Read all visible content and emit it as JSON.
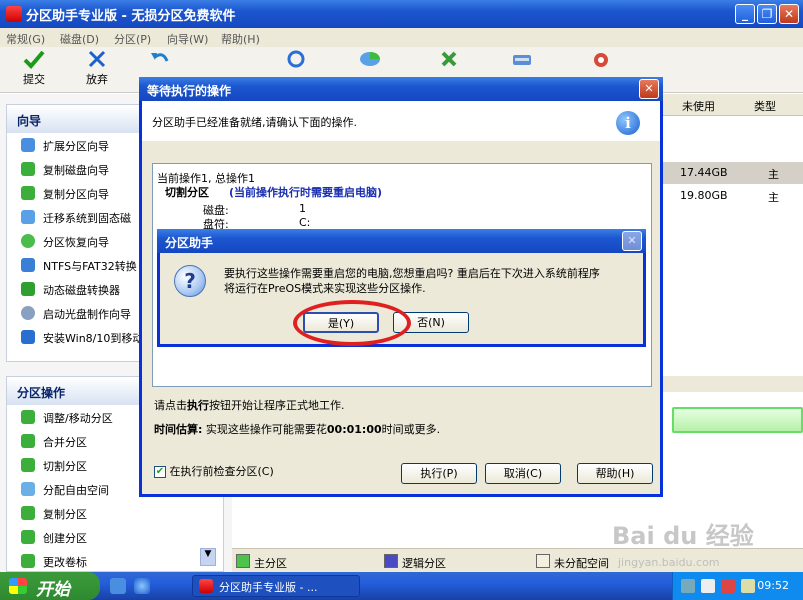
{
  "window": {
    "title": "分区助手专业版 - 无损分区免费软件",
    "buttons": {
      "minimize": "_",
      "maximize": "❐",
      "close": "✕"
    }
  },
  "menubar": [
    "常规(G)",
    "磁盘(D)",
    "分区(P)",
    "向导(W)",
    "帮助(H)"
  ],
  "toolbar": {
    "commit": "提交",
    "discard": "放弃"
  },
  "wizard_panel": {
    "title": "向导",
    "items": [
      "扩展分区向导",
      "复制磁盘向导",
      "复制分区向导",
      "迁移系统到固态磁",
      "分区恢复向导",
      "NTFS与FAT32转换",
      "动态磁盘转换器",
      "启动光盘制作向导",
      "安装Win8/10到移动"
    ]
  },
  "partition_ops_panel": {
    "title": "分区操作",
    "items": [
      "调整/移动分区",
      "合并分区",
      "切割分区",
      "分配自由空间",
      "复制分区",
      "创建分区",
      "更改卷标"
    ]
  },
  "disk_list": {
    "columns": {
      "unused": "未使用",
      "type": "类型"
    },
    "rows": [
      {
        "unused": "17.44GB",
        "type": "主"
      },
      {
        "unused": "19.80GB",
        "type": "主"
      }
    ]
  },
  "legend": {
    "primary": "主分区",
    "logical": "逻辑分区",
    "unallocated": "未分配空间"
  },
  "pending_dialog": {
    "title": "等待执行的操作",
    "message": "分区助手已经准备就绪,请确认下面的操作.",
    "info_icon": "i",
    "op_header": "当前操作1, 总操作1",
    "op_name": "切割分区",
    "op_note": "(当前操作执行时需要重启电脑)",
    "op_disk_label": "磁盘:",
    "op_disk_value": "1",
    "op_letter_label": "盘符:",
    "op_letter_value": "C:",
    "note_prefix": "请点击",
    "note_bold": "执行",
    "note_suffix": "按钮开始让程序正式地工作.",
    "estimate_label": "时间估算:",
    "estimate_prefix": " 实现这些操作可能需要花",
    "estimate_time": "00:01:00",
    "estimate_suffix": "时间或更多.",
    "check_label": "在执行前检查分区(C)",
    "execute": "执行(P)",
    "cancel": "取消(C)",
    "help": "帮助(H)"
  },
  "confirm_dialog": {
    "title": "分区助手",
    "icon": "?",
    "line1": "要执行这些操作需要重启您的电脑,您想重启吗? 重启后在下次进入系统前程序",
    "line2": "将运行在PreOS模式来实现这些分区操作.",
    "yes": "是(Y)",
    "no": "否(N)"
  },
  "taskbar": {
    "start": "开始",
    "task": "分区助手专业版 - ...",
    "clock": "09:52"
  },
  "watermark": {
    "logo": "Bai du 经验",
    "url": "jingyan.baidu.com"
  }
}
